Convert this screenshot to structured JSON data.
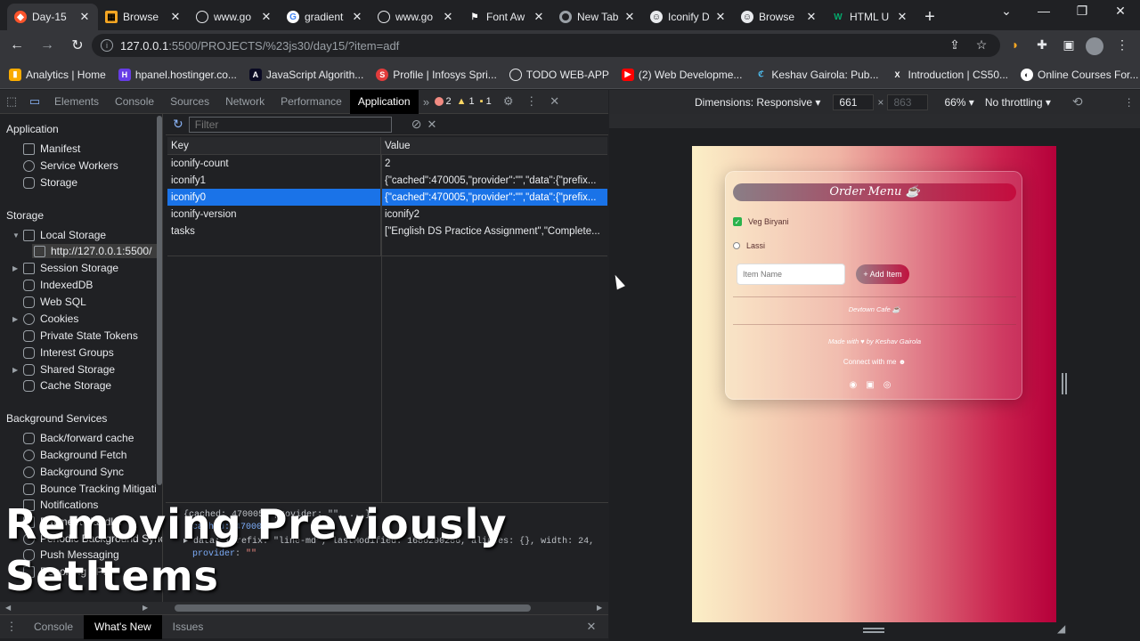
{
  "tabs": [
    {
      "label": "Day-15",
      "fav": "brave"
    },
    {
      "label": "Browse",
      "fav": "grid"
    },
    {
      "label": "www.go",
      "fav": "globe"
    },
    {
      "label": "gradient",
      "fav": "google"
    },
    {
      "label": "www.go",
      "fav": "globe"
    },
    {
      "label": "Font Aw",
      "fav": "flag"
    },
    {
      "label": "New Tab",
      "fav": "chrome"
    },
    {
      "label": "Iconify D",
      "fav": "smile"
    },
    {
      "label": "Browse",
      "fav": "smile"
    },
    {
      "label": "HTML U",
      "fav": "w"
    }
  ],
  "url": {
    "host": "127.0.0.1",
    "path": ":5500/PROJECTS/%23js30/day15/?item=adf"
  },
  "bookmarks": [
    "Analytics | Home",
    "hpanel.hostinger.co...",
    "JavaScript Algorith...",
    "Profile | Infosys Spri...",
    "TODO WEB-APP",
    "(2) Web Developme...",
    "Keshav Gairola: Pub...",
    "Introduction | CS50...",
    "Online Courses For..."
  ],
  "devtools": {
    "tabs": [
      "Elements",
      "Console",
      "Sources",
      "Network",
      "Performance",
      "Application"
    ],
    "active_tab": "Application",
    "errors": "2",
    "warnings": "1",
    "issues": "1",
    "sidebar": {
      "application_head": "Application",
      "application_items": [
        "Manifest",
        "Service Workers",
        "Storage"
      ],
      "storage_head": "Storage",
      "local_storage": "Local Storage",
      "local_origin": "http://127.0.0.1:5500/",
      "storage_items": [
        "Session Storage",
        "IndexedDB",
        "Web SQL",
        "Cookies",
        "Private State Tokens",
        "Interest Groups",
        "Shared Storage",
        "Cache Storage"
      ],
      "bg_head": "Background Services",
      "bg_items": [
        "Back/forward cache",
        "Background Fetch",
        "Background Sync",
        "Bounce Tracking Mitigati",
        "Notifications",
        "Payment Handler",
        "Periodic Background Sync",
        "Push Messaging",
        "Reporting API"
      ]
    },
    "filter_placeholder": "Filter",
    "table": {
      "key_header": "Key",
      "value_header": "Value",
      "rows": [
        {
          "key": "iconify-count",
          "value": "2"
        },
        {
          "key": "iconify1",
          "value": "{\"cached\":470005,\"provider\":\"\",\"data\":{\"prefix..."
        },
        {
          "key": "iconify0",
          "value": "{\"cached\":470005,\"provider\":\"\",\"data\":{\"prefix..."
        },
        {
          "key": "iconify-version",
          "value": "iconify2"
        },
        {
          "key": "tasks",
          "value": "[\"English DS Practice Assignment\",\"Complete..."
        }
      ],
      "selected_index": 2
    },
    "preview": {
      "line1": "{cached: 470005, provider: \"\", ...}",
      "line2_prefix": "cached: 470005",
      "line3": "data: {prefix: \"line-md\", lastModified: 1686290286, aliases: {}, width: 24,",
      "line4_key": "provider",
      "line4_val": "\"\""
    },
    "bottom_tabs": [
      "Console",
      "What's New",
      "Issues"
    ],
    "bottom_active": "What's New"
  },
  "responsive": {
    "dimensions_label": "Dimensions: Responsive",
    "width": "661",
    "height": "863",
    "zoom": "66%",
    "throttling": "No throttling"
  },
  "app": {
    "title": "Order Menu",
    "items": [
      {
        "label": "Veg Biryani",
        "checked": true
      },
      {
        "label": "Lassi",
        "checked": false
      }
    ],
    "input_placeholder": "Item Name",
    "add_button": "+ Add Item",
    "footer_cafe": "Devtown Cafe",
    "made_with": "Made with ♥ by Keshav Gairola",
    "connect": "Connect with me"
  },
  "caption": {
    "line1": "Removing Previously",
    "line2": "SetItems"
  },
  "colors": {
    "accent": "#1a73e8",
    "brand": "#c0123f"
  }
}
